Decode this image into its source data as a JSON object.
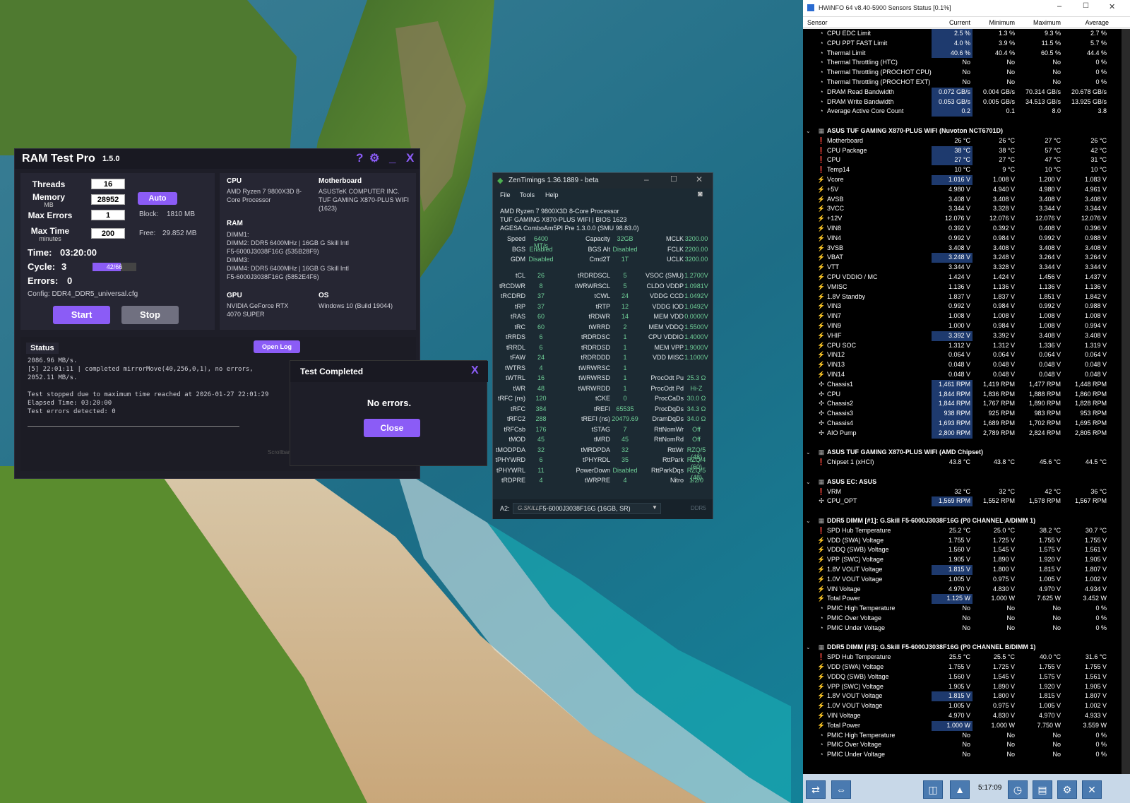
{
  "ramtest": {
    "title": "RAM Test Pro",
    "version": "1.5.0",
    "icons": {
      "help": "?",
      "settings": "⚙",
      "minimize": "_",
      "close": "X"
    },
    "threads_label": "Threads",
    "threads": "16",
    "memory_label": "Memory",
    "memory_unit": "MB",
    "memory": "28952",
    "auto_label": "Auto",
    "max_errors_label": "Max Errors",
    "max_errors": "1",
    "block_label": "Block:",
    "block": "1810 MB",
    "max_time_label": "Max Time",
    "max_time_unit": "minutes",
    "max_time": "200",
    "free_label": "Free:",
    "free": "29.852 MB",
    "time_label": "Time:",
    "time": "03:20:00",
    "cycle_label": "Cycle:",
    "cycle": "3",
    "cycle_progress": "42/66",
    "cycle_fraction": 0.64,
    "errors_label": "Errors:",
    "errors": "0",
    "config": "Config: DDR4_DDR5_universal.cfg",
    "start_label": "Start",
    "stop_label": "Stop",
    "cpu_heading": "CPU",
    "cpu": "AMD Ryzen 7 9800X3D 8-Core Processor",
    "mb_heading": "Motherboard",
    "mb": "ASUSTeK COMPUTER INC. TUF GAMING X870-PLUS WIFI (1623)",
    "ram_heading": "RAM",
    "ram_lines": [
      "DIMM1:",
      "DIMM2: DDR5 6400MHz | 16GB G Skill Intl",
      "F5-6000J3038F16G (535B28F9)",
      "DIMM3:",
      "DIMM4: DDR5 6400MHz | 16GB G Skill Intl",
      "F5-6000J3038F16G (5852E4F6)"
    ],
    "gpu_heading": "GPU",
    "gpu": "NVIDIA GeForce RTX 4070 SUPER",
    "os_heading": "OS",
    "os": "Windows 10 (Build 19044)",
    "status_label": "Status",
    "open_log_label": "Open Log",
    "log_lines": [
      "2086.96 MB/s.",
      "[5] 22:01:11 | completed mirrorMove(40,256,0,1), no errors,",
      "2052.11 MB/s.",
      "",
      "Test stopped due to maximum time reached at 2026-01-27 22:01:29",
      "Elapsed Time: 03:20:00",
      "Test errors detected: 0"
    ],
    "scrollbar_label": "Scrollbar"
  },
  "dialog": {
    "title": "Test Completed",
    "close_x": "X",
    "message": "No errors.",
    "close_label": "Close"
  },
  "zen": {
    "title": "ZenTimings 1.36.1889 - beta",
    "menu": [
      "File",
      "Tools",
      "Help"
    ],
    "info": [
      "AMD Ryzen 7 9800X3D 8-Core Processor",
      "TUF GAMING X870-PLUS WIFI | BIOS 1623",
      "AGESA ComboAm5PI Pre 1.3.0.0 (SMU 98.83.0)"
    ],
    "top_rows": [
      [
        "Speed",
        "6400 MT/s",
        "Capacity",
        "32GB",
        "MCLK",
        "3200.00"
      ],
      [
        "BGS",
        "Enabled",
        "BGS Alt",
        "Disabled",
        "FCLK",
        "2200.00"
      ],
      [
        "GDM",
        "Disabled",
        "Cmd2T",
        "1T",
        "UCLK",
        "3200.00"
      ]
    ],
    "rows": [
      [
        "tCL",
        "26",
        "tRDRDSCL",
        "5",
        "VSOC (SMU)",
        "1.2700V"
      ],
      [
        "tRCDWR",
        "8",
        "tWRWRSCL",
        "5",
        "CLDO VDDP",
        "1.0981V"
      ],
      [
        "tRCDRD",
        "37",
        "tCWL",
        "24",
        "VDDG CCD",
        "1.0492V"
      ],
      [
        "tRP",
        "37",
        "tRTP",
        "12",
        "VDDG IOD",
        "1.0492V"
      ],
      [
        "tRAS",
        "60",
        "tRDWR",
        "14",
        "MEM VDD",
        "0.0000V"
      ],
      [
        "tRC",
        "60",
        "tWRRD",
        "2",
        "MEM VDDQ",
        "1.5500V"
      ],
      [
        "tRRDS",
        "6",
        "tRDRDSC",
        "1",
        "CPU VDDIO",
        "1.4000V"
      ],
      [
        "tRRDL",
        "6",
        "tRDRDSD",
        "1",
        "MEM VPP",
        "1.9000V"
      ],
      [
        "tFAW",
        "24",
        "tRDRDDD",
        "1",
        "VDD MISC",
        "1.1000V"
      ],
      [
        "tWTRS",
        "4",
        "tWRWRSC",
        "1",
        "",
        ""
      ],
      [
        "tWTRL",
        "16",
        "tWRWRSD",
        "1",
        "ProcOdt Pu",
        "25.3 Ω"
      ],
      [
        "tWR",
        "48",
        "tWRWRDD",
        "1",
        "ProcOdt Pd",
        "Hi-Z"
      ],
      [
        "tRFC (ns)",
        "120",
        "tCKE",
        "0",
        "ProcCaDs",
        "30.0 Ω"
      ],
      [
        "tRFC",
        "384",
        "tREFI",
        "65535",
        "ProcDqDs",
        "34.3 Ω"
      ],
      [
        "tRFC2",
        "288",
        "tREFI (ns)",
        "20479.69",
        "DramDqDs",
        "34.0 Ω"
      ],
      [
        "tRFCsb",
        "176",
        "tSTAG",
        "7",
        "RttNomWr",
        "Off"
      ],
      [
        "tMOD",
        "45",
        "tMRD",
        "45",
        "RttNomRd",
        "Off"
      ],
      [
        "tMODPDA",
        "32",
        "tMRDPDA",
        "32",
        "RttWr",
        "RZQ/5 (48)"
      ],
      [
        "tPHYWRD",
        "6",
        "tPHYRDL",
        "35",
        "RttPark",
        "RZQ/4 (60)"
      ],
      [
        "tPHYWRL",
        "11",
        "PowerDown",
        "Disabled",
        "RttParkDqs",
        "RZQ/5 (48)"
      ],
      [
        "tRDPRE",
        "4",
        "tWRPRE",
        "4",
        "Nitro",
        "1/2/0"
      ]
    ],
    "slot": "A2:",
    "module": "F5-6000J3038F16G (16GB, SR)",
    "ddr": "DDR5"
  },
  "hwinfo": {
    "title": "HWiNFO 64 v8.40-5900 Sensors Status [0.1%]",
    "headers": [
      "Sensor",
      "Current",
      "Minimum",
      "Maximum",
      "Average"
    ],
    "rows": [
      {
        "t": "c",
        "n": "CPU EDC Limit",
        "v": [
          "2.5 %",
          "1.3 %",
          "9.3 %",
          "2.7 %"
        ],
        "h": 1
      },
      {
        "t": "c",
        "n": "CPU PPT FAST Limit",
        "v": [
          "4.0 %",
          "3.9 %",
          "11.5 %",
          "5.7 %"
        ],
        "h": 1
      },
      {
        "t": "c",
        "n": "Thermal Limit",
        "v": [
          "40.6 %",
          "40.4 %",
          "60.5 %",
          "44.4 %"
        ],
        "h": 1
      },
      {
        "t": "c",
        "n": "Thermal Throttling (HTC)",
        "v": [
          "No",
          "No",
          "No",
          "0 %"
        ]
      },
      {
        "t": "c",
        "n": "Thermal Throttling (PROCHOT CPU)",
        "v": [
          "No",
          "No",
          "No",
          "0 %"
        ]
      },
      {
        "t": "c",
        "n": "Thermal Throttling (PROCHOT EXT)",
        "v": [
          "No",
          "No",
          "No",
          "0 %"
        ]
      },
      {
        "t": "c",
        "n": "DRAM Read Bandwidth",
        "v": [
          "0.072 GB/s",
          "0.004 GB/s",
          "70.314 GB/s",
          "20.678 GB/s"
        ],
        "h": 1
      },
      {
        "t": "c",
        "n": "DRAM Write Bandwidth",
        "v": [
          "0.053 GB/s",
          "0.005 GB/s",
          "34.513 GB/s",
          "13.925 GB/s"
        ],
        "h": 1
      },
      {
        "t": "c",
        "n": "Average Active Core Count",
        "v": [
          "0.2",
          "0.1",
          "8.0",
          "3.8"
        ],
        "h": 1
      },
      {
        "t": "b"
      },
      {
        "t": "g",
        "n": "ASUS TUF GAMING X870-PLUS WIFI (Nuvoton NCT6701D)"
      },
      {
        "t": "t",
        "n": "Motherboard",
        "v": [
          "26 °C",
          "26 °C",
          "27 °C",
          "26 °C"
        ]
      },
      {
        "t": "t",
        "n": "CPU Package",
        "v": [
          "38 °C",
          "38 °C",
          "57 °C",
          "42 °C"
        ],
        "h": 1
      },
      {
        "t": "t",
        "n": "CPU",
        "v": [
          "27 °C",
          "27 °C",
          "47 °C",
          "31 °C"
        ],
        "h": 1
      },
      {
        "t": "t",
        "n": "Temp14",
        "v": [
          "10 °C",
          "9 °C",
          "10 °C",
          "10 °C"
        ]
      },
      {
        "t": "v",
        "n": "Vcore",
        "v": [
          "1.016 V",
          "1.008 V",
          "1.200 V",
          "1.083 V"
        ],
        "h": 1
      },
      {
        "t": "v",
        "n": "+5V",
        "v": [
          "4.980 V",
          "4.940 V",
          "4.980 V",
          "4.961 V"
        ]
      },
      {
        "t": "v",
        "n": "AVSB",
        "v": [
          "3.408 V",
          "3.408 V",
          "3.408 V",
          "3.408 V"
        ]
      },
      {
        "t": "v",
        "n": "3VCC",
        "v": [
          "3.344 V",
          "3.328 V",
          "3.344 V",
          "3.344 V"
        ]
      },
      {
        "t": "v",
        "n": "+12V",
        "v": [
          "12.076 V",
          "12.076 V",
          "12.076 V",
          "12.076 V"
        ]
      },
      {
        "t": "v",
        "n": "VIN8",
        "v": [
          "0.392 V",
          "0.392 V",
          "0.408 V",
          "0.396 V"
        ]
      },
      {
        "t": "v",
        "n": "VIN4",
        "v": [
          "0.992 V",
          "0.984 V",
          "0.992 V",
          "0.988 V"
        ]
      },
      {
        "t": "v",
        "n": "3VSB",
        "v": [
          "3.408 V",
          "3.408 V",
          "3.408 V",
          "3.408 V"
        ]
      },
      {
        "t": "v",
        "n": "VBAT",
        "v": [
          "3.248 V",
          "3.248 V",
          "3.264 V",
          "3.264 V"
        ],
        "h": 1
      },
      {
        "t": "v",
        "n": "VTT",
        "v": [
          "3.344 V",
          "3.328 V",
          "3.344 V",
          "3.344 V"
        ]
      },
      {
        "t": "v",
        "n": "CPU VDDIO / MC",
        "v": [
          "1.424 V",
          "1.424 V",
          "1.456 V",
          "1.437 V"
        ]
      },
      {
        "t": "v",
        "n": "VMISC",
        "v": [
          "1.136 V",
          "1.136 V",
          "1.136 V",
          "1.136 V"
        ]
      },
      {
        "t": "v",
        "n": "1.8V Standby",
        "v": [
          "1.837 V",
          "1.837 V",
          "1.851 V",
          "1.842 V"
        ]
      },
      {
        "t": "v",
        "n": "VIN3",
        "v": [
          "0.992 V",
          "0.984 V",
          "0.992 V",
          "0.988 V"
        ]
      },
      {
        "t": "v",
        "n": "VIN7",
        "v": [
          "1.008 V",
          "1.008 V",
          "1.008 V",
          "1.008 V"
        ]
      },
      {
        "t": "v",
        "n": "VIN9",
        "v": [
          "1.000 V",
          "0.984 V",
          "1.008 V",
          "0.994 V"
        ]
      },
      {
        "t": "v",
        "n": "VHIF",
        "v": [
          "3.392 V",
          "3.392 V",
          "3.408 V",
          "3.408 V"
        ],
        "h": 1
      },
      {
        "t": "v",
        "n": "CPU SOC",
        "v": [
          "1.312 V",
          "1.312 V",
          "1.336 V",
          "1.319 V"
        ]
      },
      {
        "t": "v",
        "n": "VIN12",
        "v": [
          "0.064 V",
          "0.064 V",
          "0.064 V",
          "0.064 V"
        ]
      },
      {
        "t": "v",
        "n": "VIN13",
        "v": [
          "0.048 V",
          "0.048 V",
          "0.048 V",
          "0.048 V"
        ]
      },
      {
        "t": "v",
        "n": "VIN14",
        "v": [
          "0.048 V",
          "0.048 V",
          "0.048 V",
          "0.048 V"
        ]
      },
      {
        "t": "f",
        "n": "Chassis1",
        "v": [
          "1,461 RPM",
          "1,419 RPM",
          "1,477 RPM",
          "1,448 RPM"
        ],
        "h": 1
      },
      {
        "t": "f",
        "n": "CPU",
        "v": [
          "1,844 RPM",
          "1,836 RPM",
          "1,888 RPM",
          "1,860 RPM"
        ],
        "h": 1
      },
      {
        "t": "f",
        "n": "Chassis2",
        "v": [
          "1,844 RPM",
          "1,767 RPM",
          "1,890 RPM",
          "1,828 RPM"
        ],
        "h": 1
      },
      {
        "t": "f",
        "n": "Chassis3",
        "v": [
          "938 RPM",
          "925 RPM",
          "983 RPM",
          "953 RPM"
        ],
        "h": 1
      },
      {
        "t": "f",
        "n": "Chassis4",
        "v": [
          "1,693 RPM",
          "1,689 RPM",
          "1,702 RPM",
          "1,695 RPM"
        ],
        "h": 1
      },
      {
        "t": "f",
        "n": "AIO Pump",
        "v": [
          "2,800 RPM",
          "2,789 RPM",
          "2,824 RPM",
          "2,805 RPM"
        ],
        "h": 1
      },
      {
        "t": "b"
      },
      {
        "t": "g",
        "n": "ASUS TUF GAMING X870-PLUS WIFI (AMD Chipset)"
      },
      {
        "t": "t",
        "n": "Chipset 1 (xHCI)",
        "v": [
          "43.8 °C",
          "43.8 °C",
          "45.6 °C",
          "44.5 °C"
        ]
      },
      {
        "t": "b"
      },
      {
        "t": "g",
        "n": "ASUS EC: ASUS"
      },
      {
        "t": "t",
        "n": "VRM",
        "v": [
          "32 °C",
          "32 °C",
          "42 °C",
          "36 °C"
        ]
      },
      {
        "t": "f",
        "n": "CPU_OPT",
        "v": [
          "1,569 RPM",
          "1,552 RPM",
          "1,578 RPM",
          "1,567 RPM"
        ],
        "h": 1
      },
      {
        "t": "b"
      },
      {
        "t": "g",
        "n": "DDR5 DIMM [#1]: G.Skill F5-6000J3038F16G (P0 CHANNEL A/DIMM 1)"
      },
      {
        "t": "t",
        "n": "SPD Hub Temperature",
        "v": [
          "25.2 °C",
          "25.0 °C",
          "38.2 °C",
          "30.7 °C"
        ]
      },
      {
        "t": "v",
        "n": "VDD (SWA) Voltage",
        "v": [
          "1.755 V",
          "1.725 V",
          "1.755 V",
          "1.755 V"
        ]
      },
      {
        "t": "v",
        "n": "VDDQ (SWB) Voltage",
        "v": [
          "1.560 V",
          "1.545 V",
          "1.575 V",
          "1.561 V"
        ]
      },
      {
        "t": "v",
        "n": "VPP (SWC) Voltage",
        "v": [
          "1.905 V",
          "1.890 V",
          "1.920 V",
          "1.905 V"
        ]
      },
      {
        "t": "v",
        "n": "1.8V VOUT Voltage",
        "v": [
          "1.815 V",
          "1.800 V",
          "1.815 V",
          "1.807 V"
        ],
        "h": 1
      },
      {
        "t": "v",
        "n": "1.0V VOUT Voltage",
        "v": [
          "1.005 V",
          "0.975 V",
          "1.005 V",
          "1.002 V"
        ]
      },
      {
        "t": "v",
        "n": "VIN Voltage",
        "v": [
          "4.970 V",
          "4.830 V",
          "4.970 V",
          "4.934 V"
        ]
      },
      {
        "t": "v",
        "n": "Total Power",
        "v": [
          "1.125 W",
          "1.000 W",
          "7.625 W",
          "3.452 W"
        ],
        "h": 1
      },
      {
        "t": "c",
        "n": "PMIC High Temperature",
        "v": [
          "No",
          "No",
          "No",
          "0 %"
        ]
      },
      {
        "t": "c",
        "n": "PMIC Over Voltage",
        "v": [
          "No",
          "No",
          "No",
          "0 %"
        ]
      },
      {
        "t": "c",
        "n": "PMIC Under Voltage",
        "v": [
          "No",
          "No",
          "No",
          "0 %"
        ]
      },
      {
        "t": "b"
      },
      {
        "t": "g",
        "n": "DDR5 DIMM [#3]: G.Skill F5-6000J3038F16G (P0 CHANNEL B/DIMM 1)"
      },
      {
        "t": "t",
        "n": "SPD Hub Temperature",
        "v": [
          "25.5 °C",
          "25.5 °C",
          "40.0 °C",
          "31.6 °C"
        ]
      },
      {
        "t": "v",
        "n": "VDD (SWA) Voltage",
        "v": [
          "1.755 V",
          "1.725 V",
          "1.755 V",
          "1.755 V"
        ]
      },
      {
        "t": "v",
        "n": "VDDQ (SWB) Voltage",
        "v": [
          "1.560 V",
          "1.545 V",
          "1.575 V",
          "1.561 V"
        ]
      },
      {
        "t": "v",
        "n": "VPP (SWC) Voltage",
        "v": [
          "1.905 V",
          "1.890 V",
          "1.920 V",
          "1.905 V"
        ]
      },
      {
        "t": "v",
        "n": "1.8V VOUT Voltage",
        "v": [
          "1.815 V",
          "1.800 V",
          "1.815 V",
          "1.807 V"
        ],
        "h": 1
      },
      {
        "t": "v",
        "n": "1.0V VOUT Voltage",
        "v": [
          "1.005 V",
          "0.975 V",
          "1.005 V",
          "1.002 V"
        ]
      },
      {
        "t": "v",
        "n": "VIN Voltage",
        "v": [
          "4.970 V",
          "4.830 V",
          "4.970 V",
          "4.933 V"
        ]
      },
      {
        "t": "v",
        "n": "Total Power",
        "v": [
          "1.000 W",
          "1.000 W",
          "7.750 W",
          "3.559 W"
        ],
        "h": 1
      },
      {
        "t": "c",
        "n": "PMIC High Temperature",
        "v": [
          "No",
          "No",
          "No",
          "0 %"
        ]
      },
      {
        "t": "c",
        "n": "PMIC Over Voltage",
        "v": [
          "No",
          "No",
          "No",
          "0 %"
        ]
      },
      {
        "t": "c",
        "n": "PMIC Under Voltage",
        "v": [
          "No",
          "No",
          "No",
          "0 %"
        ]
      }
    ],
    "footer_time": "5:17:09"
  },
  "colors": {
    "accent": "#8b5cf6",
    "zen_value": "#6fcf97",
    "hw_highlight": "#1e3a6e"
  }
}
